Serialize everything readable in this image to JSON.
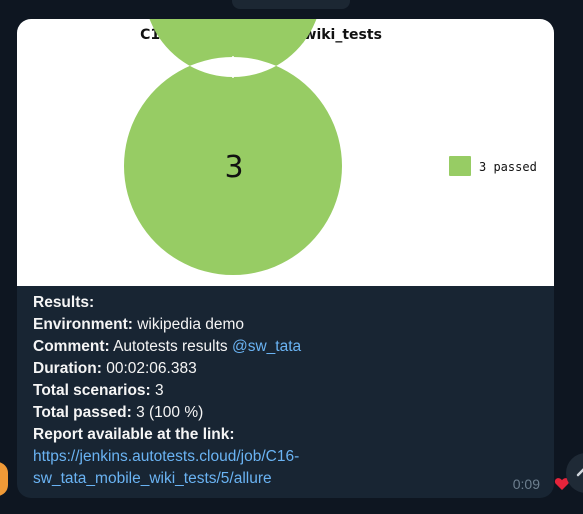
{
  "chart_data": {
    "type": "pie",
    "title": "C16-sw_tata_mobile_wiki_tests",
    "center_label": "3",
    "slices": [
      {
        "label": "passed",
        "value": 3,
        "color": "#97cc64"
      }
    ],
    "legend": {
      "placement": "right",
      "entries": [
        "3 passed"
      ]
    }
  },
  "message": {
    "results_label": "Results:",
    "environment_label": "Environment:",
    "environment_value": "wikipedia demo",
    "comment_label": "Comment:",
    "comment_value": "Autotests results",
    "comment_mention": "@sw_tata",
    "duration_label": "Duration:",
    "duration_value": "00:02:06.383",
    "total_scenarios_label": "Total scenarios:",
    "total_scenarios_value": "3",
    "total_passed_label": "Total passed:",
    "total_passed_value": "3 (100 %)",
    "report_label": "Report available at the link:",
    "report_link_line1": "https://jenkins.autotests.cloud/job/C16-",
    "report_link_line2": "sw_tata_mobile_wiki_tests/5/allure",
    "time": "0:09"
  },
  "icons": {
    "reaction": "heart-icon",
    "scroll": "chevron-up-icon"
  },
  "colors": {
    "background": "#0e1621",
    "bubble": "#182533",
    "link": "#6ab3f3",
    "passed": "#97cc64",
    "reaction": "#e5243b"
  }
}
